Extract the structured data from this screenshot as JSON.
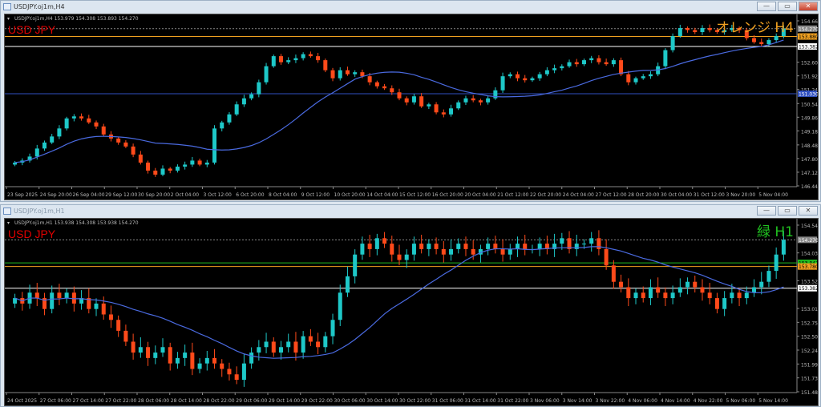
{
  "windows": [
    {
      "title": "USDJPY.oj1m,H4",
      "info": "USDJPY.oj1m,H4  153.979 154.308 153.893 154.270",
      "symbol_label": "USD JPY",
      "note_label": "オレンジ H4",
      "note_color": "#f0a020",
      "buttons": [
        "—",
        "▭",
        "✕"
      ],
      "price_range": [
        146.44,
        154.66
      ],
      "price_ticks": [
        "154.660",
        "153.980",
        "152.600",
        "151.920",
        "151.240",
        "150.540",
        "149.860",
        "149.180",
        "148.480",
        "147.800",
        "147.120",
        "146.440"
      ],
      "levels": [
        {
          "value": 154.27,
          "label": "154.270",
          "color": "#888888"
        },
        {
          "value": 153.88,
          "label": "153.880",
          "color": "#f0a020"
        },
        {
          "value": 153.382,
          "label": "153.382",
          "color": "#ffffff"
        },
        {
          "value": 151.03,
          "label": "151.030",
          "color": "#3050c0"
        }
      ],
      "time_labels": [
        "23 Sep 2025",
        "24 Sep 20:00",
        "26 Sep 04:00",
        "29 Sep 12:00",
        "30 Sep 20:00",
        "2 Oct 04:00",
        "3 Oct 12:00",
        "6 Oct 20:00",
        "8 Oct 04:00",
        "9 Oct 12:00",
        "10 Oct 20:00",
        "14 Oct 04:00",
        "15 Oct 12:00",
        "16 Oct 20:00",
        "20 Oct 04:00",
        "21 Oct 12:00",
        "22 Oct 20:00",
        "24 Oct 04:00",
        "27 Oct 12:00",
        "28 Oct 20:00",
        "30 Oct 04:00",
        "31 Oct 12:00",
        "3 Nov 20:00",
        "5 Nov 04:00"
      ],
      "closes": [
        147.6,
        147.7,
        147.9,
        148.3,
        148.6,
        148.9,
        149.3,
        149.8,
        149.9,
        149.8,
        149.6,
        149.4,
        149.0,
        148.8,
        148.6,
        148.4,
        148.0,
        147.6,
        147.2,
        147.0,
        147.3,
        147.2,
        147.4,
        147.5,
        147.7,
        147.5,
        147.6,
        149.3,
        149.6,
        150.0,
        150.5,
        150.8,
        151.0,
        151.6,
        152.4,
        152.9,
        152.6,
        152.7,
        152.8,
        153.0,
        152.9,
        152.7,
        152.2,
        151.8,
        152.2,
        152.0,
        152.1,
        151.9,
        151.6,
        151.4,
        151.3,
        151.1,
        150.8,
        150.6,
        150.9,
        150.4,
        150.5,
        150.1,
        150.0,
        150.3,
        150.6,
        150.8,
        150.7,
        150.6,
        150.8,
        151.2,
        151.9,
        152.0,
        151.8,
        151.7,
        151.8,
        152.0,
        152.2,
        152.3,
        152.4,
        152.6,
        152.5,
        152.7,
        152.8,
        152.6,
        152.5,
        152.7,
        152.0,
        151.6,
        151.8,
        151.9,
        152.0,
        152.4,
        153.2,
        153.9,
        154.3,
        154.2,
        154.1,
        154.3,
        154.2,
        154.1,
        154.2,
        154.3,
        154.2,
        153.8,
        153.6,
        153.5,
        153.7,
        153.9,
        154.27
      ]
    },
    {
      "title": "USDJPY.oj1m,H1",
      "info": "USDJPY.oj1m,H1  153.938 154.308 153.938 154.270",
      "symbol_label": "USD JPY",
      "note_label": "緑 H1",
      "note_color": "#20c020",
      "buttons": [
        "—",
        "▭",
        "✕"
      ],
      "price_range": [
        151.48,
        154.54
      ],
      "price_ticks": [
        "154.540",
        "154.030",
        "153.520",
        "153.010",
        "152.755",
        "152.500",
        "152.245",
        "151.990",
        "151.735",
        "151.480"
      ],
      "levels": [
        {
          "value": 154.27,
          "label": "154.270",
          "color": "#888888"
        },
        {
          "value": 153.847,
          "label": "153.847",
          "color": "#20c020"
        },
        {
          "value": 153.78,
          "label": "153.780",
          "color": "#f0a020"
        },
        {
          "value": 153.382,
          "label": "153.382",
          "color": "#ffffff"
        }
      ],
      "time_labels": [
        "24 Oct 2025",
        "27 Oct 06:00",
        "27 Oct 14:00",
        "27 Oct 22:00",
        "28 Oct 06:00",
        "28 Oct 14:00",
        "28 Oct 22:00",
        "29 Oct 06:00",
        "29 Oct 14:00",
        "29 Oct 22:00",
        "30 Oct 06:00",
        "30 Oct 14:00",
        "30 Oct 22:00",
        "31 Oct 06:00",
        "31 Oct 14:00",
        "31 Oct 22:00",
        "3 Nov 06:00",
        "3 Nov 14:00",
        "3 Nov 22:00",
        "4 Nov 06:00",
        "4 Nov 14:00",
        "4 Nov 22:00",
        "5 Nov 06:00",
        "5 Nov 14:00"
      ],
      "closes": [
        153.2,
        153.1,
        153.3,
        153.2,
        153.0,
        153.3,
        153.2,
        153.3,
        153.1,
        153.2,
        153.0,
        153.1,
        152.9,
        152.8,
        152.6,
        152.4,
        152.2,
        152.3,
        152.1,
        152.2,
        152.3,
        152.0,
        152.1,
        152.2,
        151.9,
        152.0,
        152.1,
        152.0,
        151.9,
        151.8,
        151.7,
        152.0,
        152.2,
        152.3,
        152.4,
        152.2,
        152.3,
        152.4,
        152.2,
        152.5,
        152.4,
        152.3,
        152.5,
        152.8,
        153.3,
        153.6,
        154.0,
        154.2,
        154.1,
        154.3,
        154.2,
        154.0,
        153.9,
        154.0,
        154.2,
        154.1,
        154.2,
        154.1,
        154.0,
        154.1,
        154.2,
        154.1,
        154.0,
        154.1,
        154.2,
        154.1,
        154.0,
        154.1,
        154.2,
        154.1,
        154.1,
        154.2,
        154.1,
        154.2,
        154.3,
        154.1,
        154.2,
        154.2,
        154.3,
        154.1,
        153.8,
        153.5,
        153.4,
        153.2,
        153.3,
        153.2,
        153.4,
        153.3,
        153.2,
        153.3,
        153.4,
        153.5,
        153.4,
        153.3,
        153.2,
        153.0,
        153.2,
        153.3,
        153.2,
        153.3,
        153.4,
        153.5,
        153.7,
        154.0,
        154.27
      ]
    }
  ],
  "colors": {
    "up": "#1ec8c8",
    "down": "#ff4a1a",
    "ma": "#4a6ae0",
    "grid": "#333333",
    "axis_text": "#bbbbbb"
  }
}
